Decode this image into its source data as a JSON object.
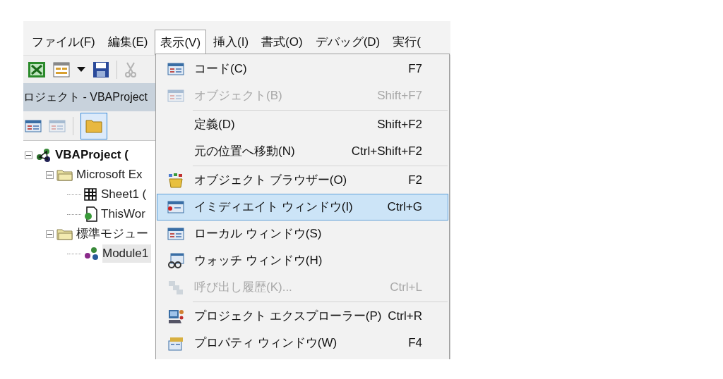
{
  "menu_bar": [
    {
      "label": "ファイル(F)",
      "selected": false
    },
    {
      "label": "編集(E)",
      "selected": false
    },
    {
      "label": "表示(V)",
      "selected": true
    },
    {
      "label": "挿入(I)",
      "selected": false
    },
    {
      "label": "書式(O)",
      "selected": false
    },
    {
      "label": "デバッグ(D)",
      "selected": false
    },
    {
      "label": "実行(",
      "selected": false
    }
  ],
  "project_panel": {
    "title": "ロジェクト - VBAProject",
    "tree": [
      {
        "label": "VBAProject (",
        "expanded": true,
        "selected": false,
        "children": [
          {
            "label": "Microsoft Ex",
            "expanded": true,
            "selected": false,
            "children": [
              {
                "label": "Sheet1 (",
                "selected": false
              },
              {
                "label": "ThisWor",
                "selected": false
              }
            ]
          },
          {
            "label": "標準モジュー",
            "expanded": true,
            "selected": false,
            "children": [
              {
                "label": "Module1",
                "selected": true
              }
            ]
          }
        ]
      }
    ]
  },
  "view_menu": [
    {
      "label": "コード(C)",
      "shortcut": "F7",
      "disabled": false,
      "selected": false,
      "separator_before": false
    },
    {
      "label": "オブジェクト(B)",
      "shortcut": "Shift+F7",
      "disabled": true,
      "selected": false,
      "separator_before": false
    },
    {
      "label": "定義(D)",
      "shortcut": "Shift+F2",
      "disabled": false,
      "selected": false,
      "separator_before": true
    },
    {
      "label": "元の位置へ移動(N)",
      "shortcut": "Ctrl+Shift+F2",
      "disabled": false,
      "selected": false,
      "separator_before": false
    },
    {
      "label": "オブジェクト ブラウザー(O)",
      "shortcut": "F2",
      "disabled": false,
      "selected": false,
      "separator_before": true
    },
    {
      "label": "イミディエイト ウィンドウ(I)",
      "shortcut": "Ctrl+G",
      "disabled": false,
      "selected": true,
      "separator_before": false
    },
    {
      "label": "ローカル ウィンドウ(S)",
      "disabled": false,
      "selected": false,
      "separator_before": false
    },
    {
      "label": "ウォッチ ウィンドウ(H)",
      "disabled": false,
      "selected": false,
      "separator_before": false
    },
    {
      "label": "呼び出し履歴(K)...",
      "shortcut": "Ctrl+L",
      "disabled": true,
      "selected": false,
      "separator_before": false
    },
    {
      "label": "プロジェクト エクスプローラー(P)",
      "shortcut": "Ctrl+R",
      "disabled": false,
      "selected": false,
      "separator_before": true
    },
    {
      "label": "プロパティ ウィンドウ(W)",
      "shortcut": "F4",
      "disabled": false,
      "selected": false,
      "separator_before": false
    }
  ]
}
